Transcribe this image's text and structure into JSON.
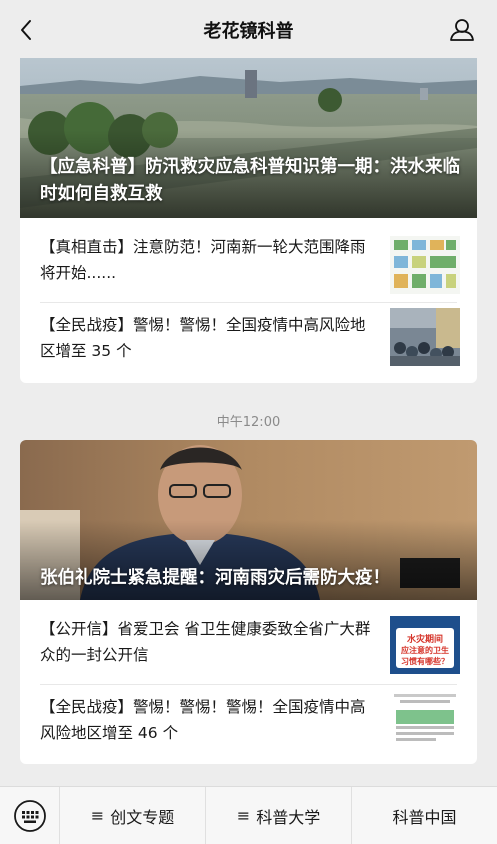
{
  "header": {
    "title": "老花镜科普",
    "back_icon": "chevron-left-icon",
    "profile_icon": "user-icon"
  },
  "message1": {
    "headline": "【应急科普】防汛救灾应急科普知识第一期：洪水来临时如何自救互救",
    "items": [
      {
        "text": "【真相直击】注意防范！河南新一轮大范围降雨将开始......"
      },
      {
        "text": "【全民战疫】警惕！警惕！全国疫情中高风险地区增至 35 个"
      }
    ]
  },
  "timestamp": "中午12:00",
  "message2": {
    "headline": "张伯礼院士紧急提醒：河南雨灾后需防大疫！",
    "items": [
      {
        "text": "【公开信】省爱卫会 省卫生健康委致全省广大群众的一封公开信",
        "thumb_text": "水灾期间应注意的卫生习惯有哪些？"
      },
      {
        "text": "【全民战疫】警惕！警惕！警惕！全国疫情中高风险地区增至 46 个"
      }
    ]
  },
  "bottom_menu": {
    "keyboard_icon": "keyboard-icon",
    "items": [
      {
        "label": "创文专题",
        "icon": "≡"
      },
      {
        "label": "科普大学",
        "icon": "≡"
      },
      {
        "label": "科普中国",
        "icon": ""
      }
    ]
  },
  "colors": {
    "background": "#ededed",
    "card": "#ffffff",
    "accent_dot": "#fa9d3b"
  }
}
